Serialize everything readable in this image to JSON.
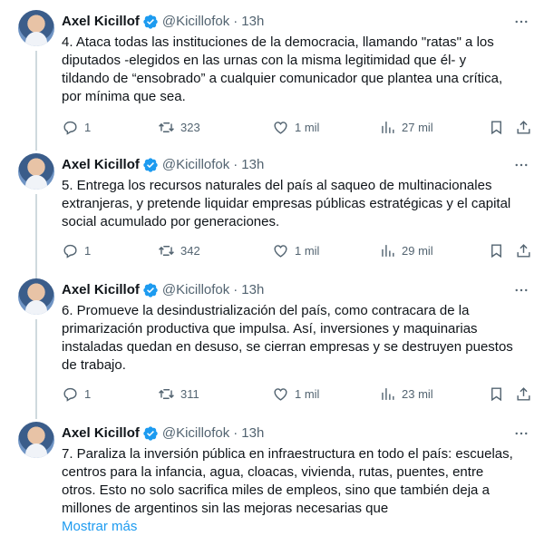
{
  "colors": {
    "text": "#0f1419",
    "secondary": "#536471",
    "accent": "#1d9bf0",
    "thread_line": "#cfd9de"
  },
  "icons": {
    "verified": "verified-badge-icon",
    "more": "more-options-icon",
    "reply": "reply-icon",
    "retweet": "retweet-icon",
    "like": "heart-icon",
    "views": "views-chart-icon",
    "bookmark": "bookmark-icon",
    "share": "share-icon"
  },
  "tweets": [
    {
      "name": "Axel Kicillof",
      "handle": "@Kicillofok",
      "separator": "·",
      "time": "13h",
      "text": "4. Ataca todas las instituciones de la democracia, llamando \"ratas\" a los\ndiputados -elegidos en las urnas con la misma legitimidad que él- y\ntildando de “ensobrado” a cualquier comunicador que plantea una crítica,\npor mínima que sea.",
      "replies": "1",
      "retweets": "323",
      "likes": "1 mil",
      "views": "27 mil"
    },
    {
      "name": "Axel Kicillof",
      "handle": "@Kicillofok",
      "separator": "·",
      "time": "13h",
      "text": "5. Entrega los recursos naturales del país al saqueo de multinacionales\nextranjeras, y pretende liquidar empresas públicas estratégicas y el capital\nsocial acumulado por generaciones.",
      "replies": "1",
      "retweets": "342",
      "likes": "1 mil",
      "views": "29 mil"
    },
    {
      "name": "Axel Kicillof",
      "handle": "@Kicillofok",
      "separator": "·",
      "time": "13h",
      "text": "6. Promueve la desindustrialización del país, como contracara de la\nprimarización productiva que impulsa. Así, inversiones y maquinarias\ninstaladas quedan en desuso, se cierran empresas y se destruyen puestos\nde trabajo.",
      "replies": "1",
      "retweets": "311",
      "likes": "1 mil",
      "views": "23 mil"
    },
    {
      "name": "Axel Kicillof",
      "handle": "@Kicillofok",
      "separator": "·",
      "time": "13h",
      "text": "7. Paraliza la inversión pública en infraestructura en todo el país: escuelas,\ncentros para la infancia, agua, cloacas, vivienda, rutas, puentes, entre\notros. Esto no solo sacrifica miles de empleos, sino que también deja a\nmillones de argentinos sin las mejoras necesarias que",
      "show_more": "Mostrar más"
    }
  ]
}
